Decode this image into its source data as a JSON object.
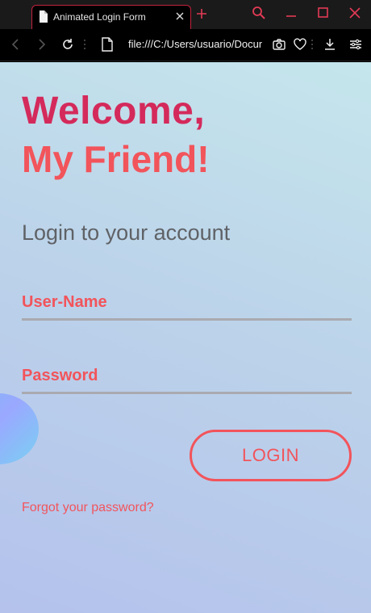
{
  "browser": {
    "tab_title": "Animated Login Form",
    "url": "file:///C:/Users/usuario/Documents"
  },
  "page": {
    "welcome": "Welcome,",
    "friend": "My Friend!",
    "subtitle": "Login to your account",
    "username_label": "User-Name",
    "password_label": "Password",
    "login_button": "LOGIN",
    "forgot_link": "Forgot your password?"
  },
  "colors": {
    "accent_dark": "#d42a5b",
    "accent": "#f2545b",
    "chrome_border": "#c3223e"
  }
}
